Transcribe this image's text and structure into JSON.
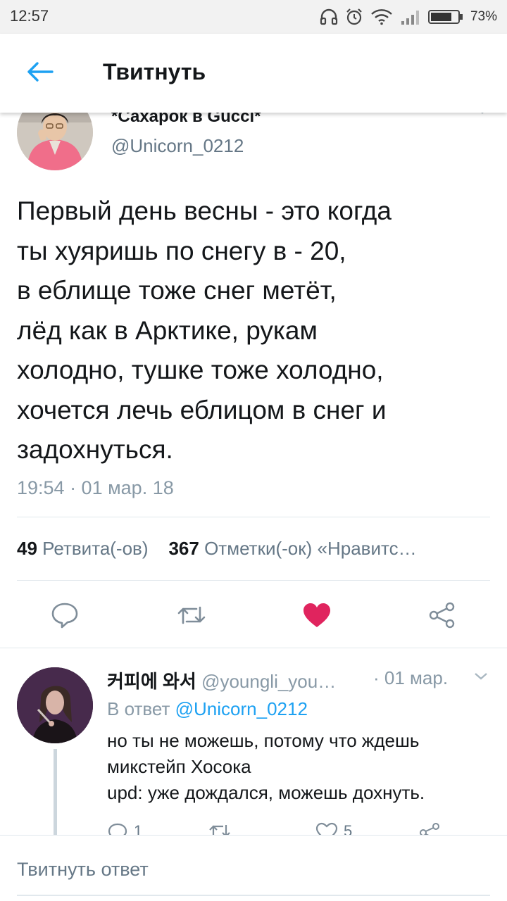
{
  "status_bar": {
    "time": "12:57",
    "battery_percent": "73%",
    "icons": [
      "headphones-icon",
      "alarm-icon",
      "wifi-icon",
      "signal-icon",
      "battery-icon"
    ]
  },
  "header": {
    "title": "Твитнуть",
    "back_icon": "back-arrow-icon"
  },
  "tweet": {
    "display_name": "*Сахарок в Gucci*",
    "handle": "@Unicorn_0212",
    "text_lines": [
      "Первый день весны - это когда",
      "ты хуяришь по снегу в - 20,",
      "в еблище тоже снег метёт,",
      "лёд как в Арктике, рукам",
      "холодно, тушке тоже холодно,",
      "хочется лечь еблицом в снег и",
      "задохнуться."
    ],
    "timestamp": "19:54 · 01 мар. 18",
    "retweets_count": "49",
    "retweets_label": "Ретвита(-ов)",
    "likes_count": "367",
    "likes_label": "Отметки(-ок) «Нравитс…",
    "liked": true
  },
  "reply": {
    "display_name": "커피에 와서",
    "handle": "@youngli_you…",
    "date": "· 01 мар.",
    "reply_to_prefix": "В ответ",
    "reply_to_mention": "@Unicorn_0212",
    "text_lines": [
      "но ты не можешь, потому что ждешь",
      "микстейп Хосока",
      "upd: уже дождался, можешь дохнуть."
    ],
    "reply_count": "1",
    "like_count": "5"
  },
  "compose": {
    "placeholder": "Твитнуть ответ"
  },
  "colors": {
    "accent": "#1da1f2",
    "like": "#e0245e",
    "secondary_text": "#657786",
    "status_bar_bg": "#f2f2f2"
  }
}
